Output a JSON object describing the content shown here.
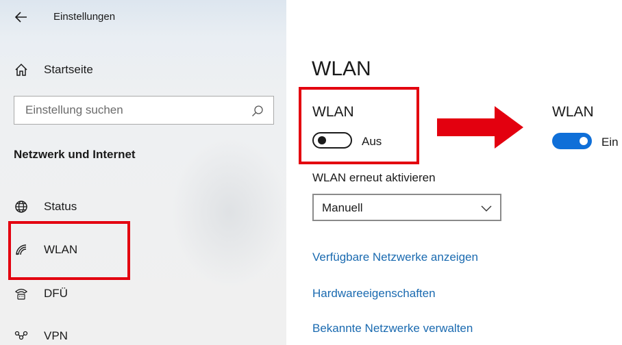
{
  "colors": {
    "accent": "#0f6fd8",
    "link": "#1a6ab0",
    "highlight": "#e3000f",
    "arrow": "#e3000f"
  },
  "window": {
    "title": "Einstellungen",
    "back_icon": "arrow-left-icon"
  },
  "sidebar": {
    "home": {
      "label": "Startseite",
      "icon": "home-icon"
    },
    "search": {
      "placeholder": "Einstellung suchen",
      "value": "",
      "icon": "search-icon"
    },
    "section_title": "Netzwerk und Internet",
    "items": [
      {
        "label": "Status",
        "icon": "globe-icon"
      },
      {
        "label": "WLAN",
        "icon": "wifi-icon",
        "selected": true
      },
      {
        "label": "DFÜ",
        "icon": "dialup-icon"
      },
      {
        "label": "VPN",
        "icon": "vpn-icon"
      }
    ]
  },
  "main": {
    "title": "WLAN",
    "wlan_off": {
      "label": "WLAN",
      "state": "Aus",
      "on": false
    },
    "wlan_on": {
      "label": "WLAN",
      "state": "Ein",
      "on": true
    },
    "reactivate": {
      "label": "WLAN erneut aktivieren",
      "selected": "Manuell"
    },
    "links": [
      "Verfügbare Netzwerke anzeigen",
      "Hardwareeigenschaften",
      "Bekannte Netzwerke verwalten"
    ]
  }
}
